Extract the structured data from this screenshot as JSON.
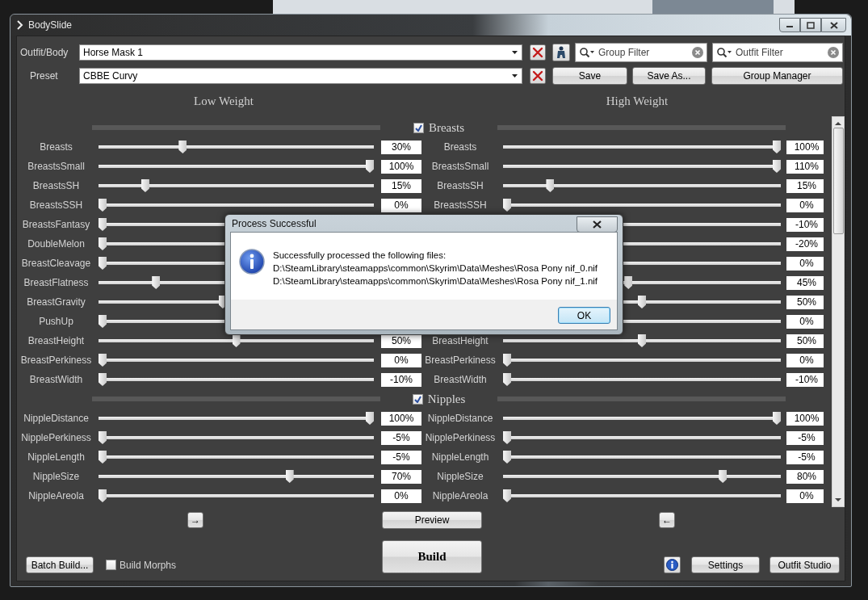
{
  "window": {
    "title": "BodySlide"
  },
  "outfit": {
    "label": "Outfit/Body",
    "value": "Horse Mask 1"
  },
  "filters": [
    {
      "placeholder": "Group Filter"
    },
    {
      "placeholder": "Outfit Filter"
    }
  ],
  "preset": {
    "label": "Preset",
    "value": "CBBE Curvy"
  },
  "preset_buttons": [
    "Save",
    "Save As...",
    "Group Manager"
  ],
  "weight_headings": [
    "Low Weight",
    "High Weight"
  ],
  "groups": [
    {
      "name": "Breasts",
      "checked": true,
      "rows": [
        {
          "low": {
            "label": "Breasts",
            "level": 0.3,
            "value": "30%"
          },
          "high": {
            "label": "Breasts",
            "level": 1,
            "value": "100%"
          }
        },
        {
          "low": {
            "label": "BreastsSmall",
            "level": 1,
            "value": "100%"
          },
          "high": {
            "label": "BreastsSmall",
            "level": 1,
            "value": "110%"
          }
        },
        {
          "low": {
            "label": "BreastsSH",
            "level": 0.16,
            "value": "15%"
          },
          "high": {
            "label": "BreastsSH",
            "level": 0.16,
            "value": "15%"
          }
        },
        {
          "low": {
            "label": "BreastsSSH",
            "level": 0,
            "value": "0%"
          },
          "high": {
            "label": "BreastsSSH",
            "level": 0,
            "value": "0%"
          }
        },
        {
          "low": {
            "label": "BreastsFantasy",
            "level": 0
          },
          "high": {
            "value": "-10%"
          }
        },
        {
          "low": {
            "label": "DoubleMelon",
            "level": 0
          },
          "high": {
            "value": "-20%"
          }
        },
        {
          "low": {
            "label": "BreastCleavage",
            "level": 0
          },
          "high": {
            "value": "0%"
          }
        },
        {
          "low": {
            "label": "BreastFlatness",
            "level": 0.2
          },
          "high": {
            "level": 0.45,
            "value": "45%"
          }
        },
        {
          "low": {
            "label": "BreastGravity",
            "level": 0.45
          },
          "high": {
            "level": 0.5,
            "value": "50%"
          }
        },
        {
          "low": {
            "label": "PushUp",
            "level": 0
          },
          "high": {
            "value": "0%"
          }
        },
        {
          "low": {
            "label": "BreastHeight",
            "level": 0.5,
            "value": "50%"
          },
          "high": {
            "label": "BreastHeight",
            "level": 0.5,
            "value": "50%"
          }
        },
        {
          "low": {
            "label": "BreastPerkiness",
            "level": 0,
            "value": "0%"
          },
          "high": {
            "label": "BreastPerkiness",
            "level": 0,
            "value": "0%"
          }
        },
        {
          "low": {
            "label": "BreastWidth",
            "level": 0,
            "value": "-10%"
          },
          "high": {
            "label": "BreastWidth",
            "level": 0,
            "value": "-10%"
          }
        }
      ]
    },
    {
      "name": "Nipples",
      "checked": true,
      "rows": [
        {
          "low": {
            "label": "NippleDistance",
            "level": 1,
            "value": "100%"
          },
          "high": {
            "label": "NippleDistance",
            "level": 1,
            "value": "100%"
          }
        },
        {
          "low": {
            "label": "NipplePerkiness",
            "level": 0,
            "value": "-5%"
          },
          "high": {
            "label": "NipplePerkiness",
            "level": 0,
            "value": "-5%"
          }
        },
        {
          "low": {
            "label": "NippleLength",
            "level": 0,
            "value": "-5%"
          },
          "high": {
            "label": "NippleLength",
            "level": 0,
            "value": "-5%"
          }
        },
        {
          "low": {
            "label": "NippleSize",
            "level": 0.7,
            "value": "70%"
          },
          "high": {
            "label": "NippleSize",
            "level": 0.8,
            "value": "80%"
          }
        },
        {
          "low": {
            "label": "NippleAreola",
            "level": 0,
            "value": "0%"
          },
          "high": {
            "label": "NippleAreola",
            "level": 0,
            "value": "0%"
          }
        }
      ]
    }
  ],
  "transfer_buttons": [
    "→",
    "←"
  ],
  "preview_button": "Preview",
  "build_button": "Build",
  "batch_build_button": "Batch Build...",
  "build_morphs": {
    "label": "Build Morphs",
    "checked": false
  },
  "settings_button": "Settings",
  "outfit_studio_button": "Outfit Studio",
  "dialog": {
    "title": "Process Successful",
    "lines": [
      "Successfully processed the following files:",
      "D:\\SteamLibrary\\steamapps\\common\\Skyrim\\Data\\Meshes\\Rosa Pony nif_0.nif",
      "D:\\SteamLibrary\\steamapps\\common\\Skyrim\\Data\\Meshes\\Rosa Pony nif_1.nif"
    ],
    "button": "OK"
  }
}
